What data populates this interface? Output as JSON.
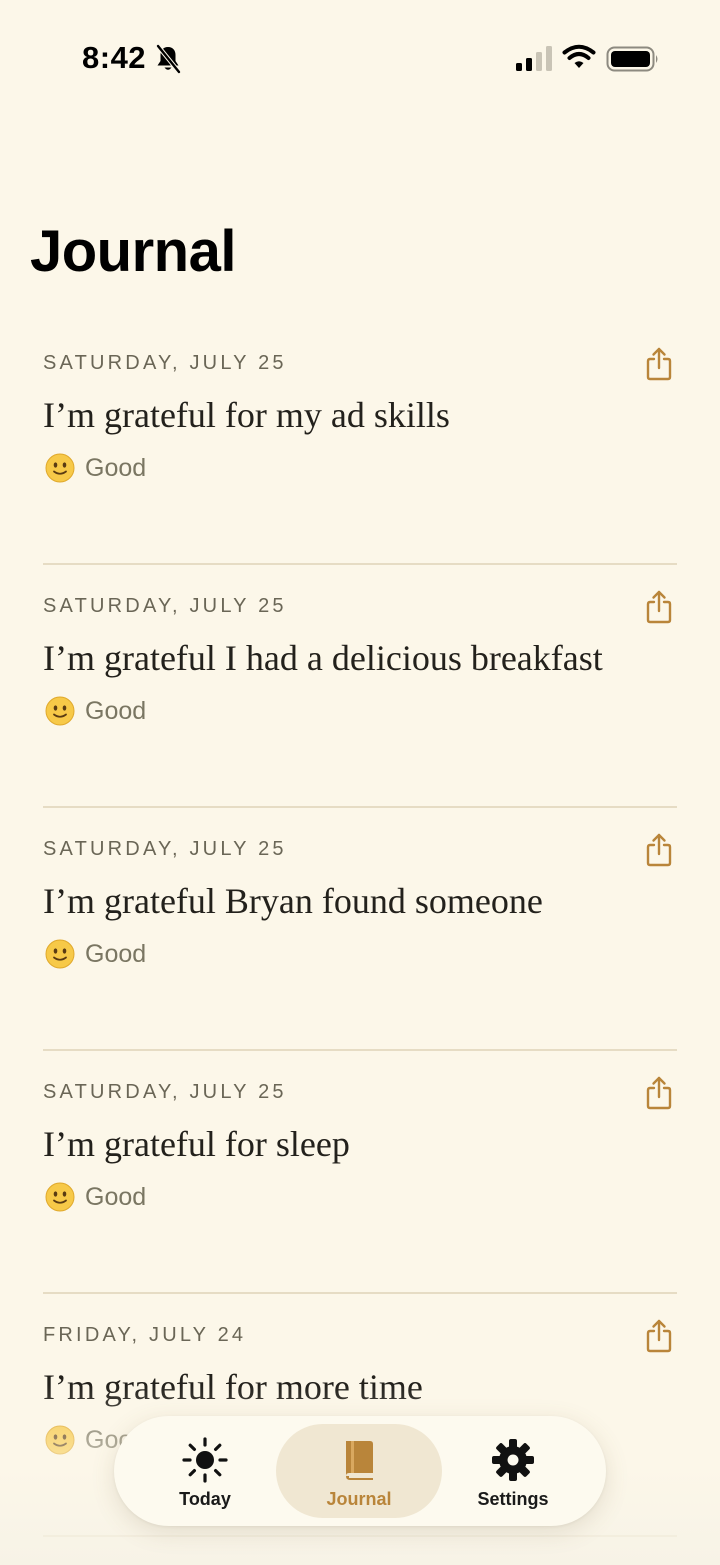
{
  "status_bar": {
    "time": "8:42"
  },
  "page": {
    "title": "Journal"
  },
  "entries": [
    {
      "date": "SATURDAY, JULY 25",
      "text": "I’m grateful for my ad skills",
      "mood": "Good"
    },
    {
      "date": "SATURDAY, JULY 25",
      "text": "I’m grateful I had a delicious breakfast",
      "mood": "Good"
    },
    {
      "date": "SATURDAY, JULY 25",
      "text": "I’m grateful Bryan found someone",
      "mood": "Good"
    },
    {
      "date": "SATURDAY, JULY 25",
      "text": "I’m grateful for sleep",
      "mood": "Good"
    },
    {
      "date": "FRIDAY, JULY 24",
      "text": "I’m grateful for more time",
      "mood": "Good"
    }
  ],
  "tab_bar": {
    "tabs": [
      {
        "label": "Today",
        "icon": "sun-icon",
        "active": false
      },
      {
        "label": "Journal",
        "icon": "book-icon",
        "active": true
      },
      {
        "label": "Settings",
        "icon": "gear-icon",
        "active": false
      }
    ]
  },
  "colors": {
    "background": "#fcf7e9",
    "accent": "#b9853a",
    "divider": "#e6dcc4"
  }
}
